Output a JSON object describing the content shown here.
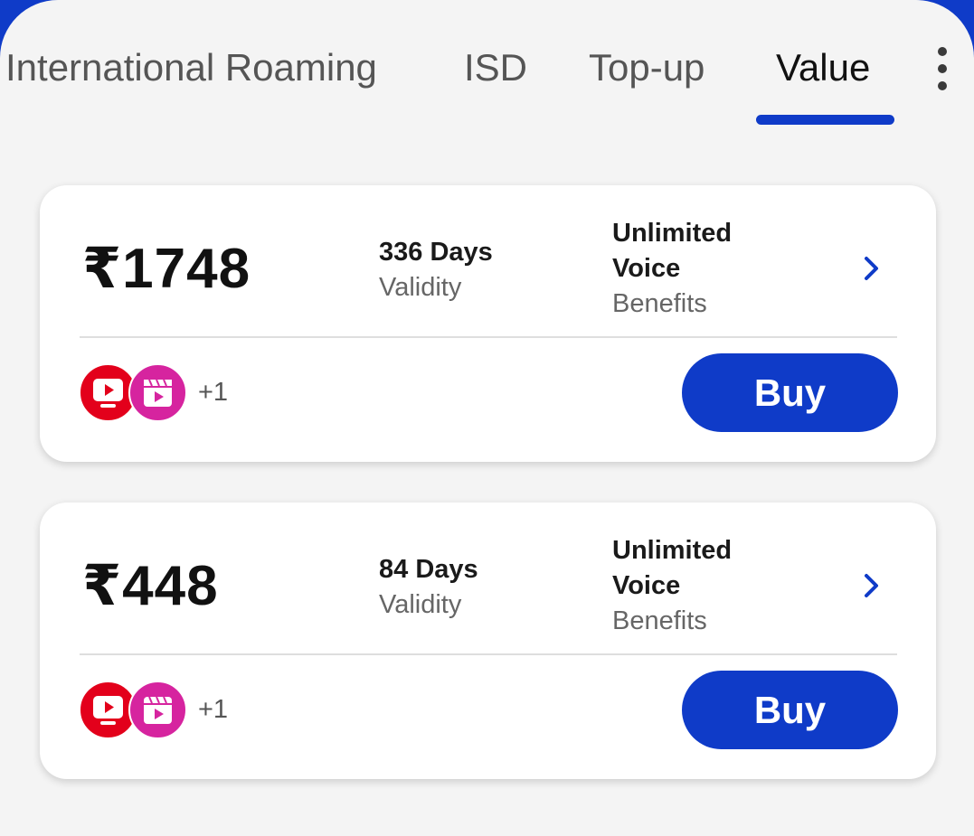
{
  "tabs": {
    "items": [
      {
        "label": "International Roaming",
        "active": false
      },
      {
        "label": "ISD",
        "active": false
      },
      {
        "label": "Top-up",
        "active": false
      },
      {
        "label": "Value",
        "active": true
      }
    ],
    "more_icon": "more-vertical-icon"
  },
  "plans": [
    {
      "price": "₹1748",
      "validity_value": "336 Days",
      "validity_label": "Validity",
      "benefit_value": "Unlimited Voice",
      "benefit_label": "Benefits",
      "ott_icons": [
        "tv-app-icon",
        "cinema-app-icon"
      ],
      "more_apps": "+1",
      "buy_label": "Buy"
    },
    {
      "price": "₹448",
      "validity_value": "84 Days",
      "validity_label": "Validity",
      "benefit_value": "Unlimited Voice",
      "benefit_label": "Benefits",
      "ott_icons": [
        "tv-app-icon",
        "cinema-app-icon"
      ],
      "more_apps": "+1",
      "buy_label": "Buy"
    }
  ],
  "colors": {
    "accent": "#0f3bc8",
    "background": "#f4f4f4",
    "card": "#ffffff",
    "tv_icon": "#e3001b",
    "cinema_icon": "#d6249f"
  }
}
